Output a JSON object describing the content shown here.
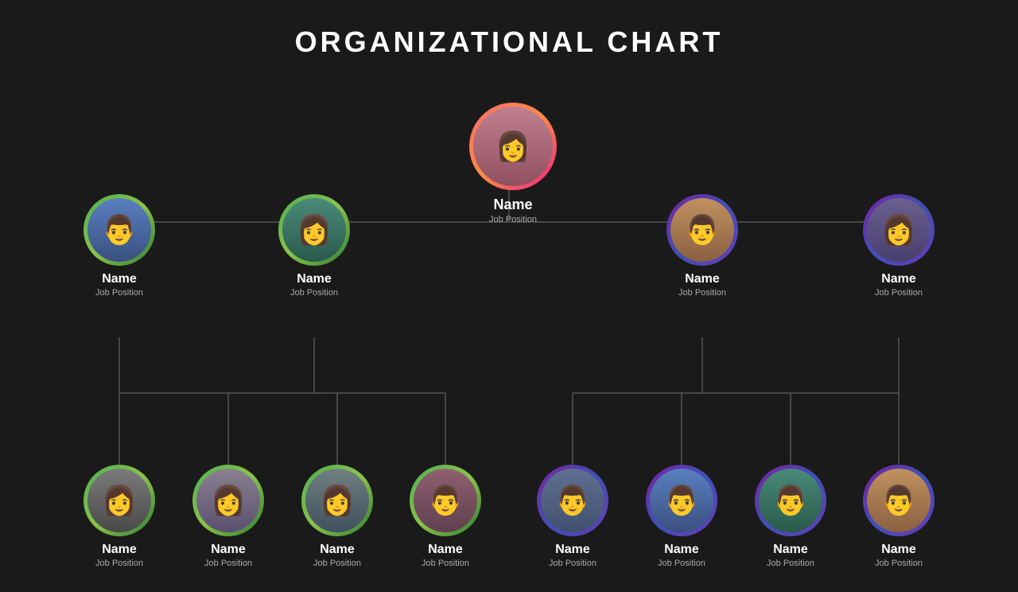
{
  "title": "ORGANIZATIONAL CHART",
  "nodes": {
    "top": {
      "name": "Name",
      "position": "Job Position",
      "ring": "ring-pink-orange",
      "person": "person-top"
    },
    "l1": [
      {
        "id": "n1",
        "name": "Name",
        "position": "Job Position",
        "ring": "ring-green",
        "person": "person-1"
      },
      {
        "id": "n2",
        "name": "Name",
        "position": "Job Position",
        "ring": "ring-green",
        "person": "person-2"
      },
      {
        "id": "n3",
        "name": "Name",
        "position": "Job Position",
        "ring": "ring-purple-blue",
        "person": "person-3"
      },
      {
        "id": "n4",
        "name": "Name",
        "position": "Job Position",
        "ring": "ring-purple-blue",
        "person": "person-4"
      }
    ],
    "l2_left": [
      {
        "id": "n5",
        "name": "Name",
        "position": "Job Position",
        "ring": "ring-green",
        "person": "person-5"
      },
      {
        "id": "n6",
        "name": "Name",
        "position": "Job Position",
        "ring": "ring-green",
        "person": "person-6"
      },
      {
        "id": "n7",
        "name": "Name",
        "position": "Job Position",
        "ring": "ring-green",
        "person": "person-7"
      },
      {
        "id": "n8",
        "name": "Name",
        "position": "Job Position",
        "ring": "ring-green",
        "person": "person-8"
      }
    ],
    "l2_right": [
      {
        "id": "n9",
        "name": "Name",
        "position": "Job Position",
        "ring": "ring-purple-blue",
        "person": "person-9"
      },
      {
        "id": "n10",
        "name": "Name",
        "position": "Job Position",
        "ring": "ring-purple-blue",
        "person": "person-1"
      },
      {
        "id": "n11",
        "name": "Name",
        "position": "Job Position",
        "ring": "ring-purple-blue",
        "person": "person-2"
      },
      {
        "id": "n12",
        "name": "Name",
        "position": "Job Position",
        "ring": "ring-purple-blue",
        "person": "person-3"
      }
    ]
  }
}
